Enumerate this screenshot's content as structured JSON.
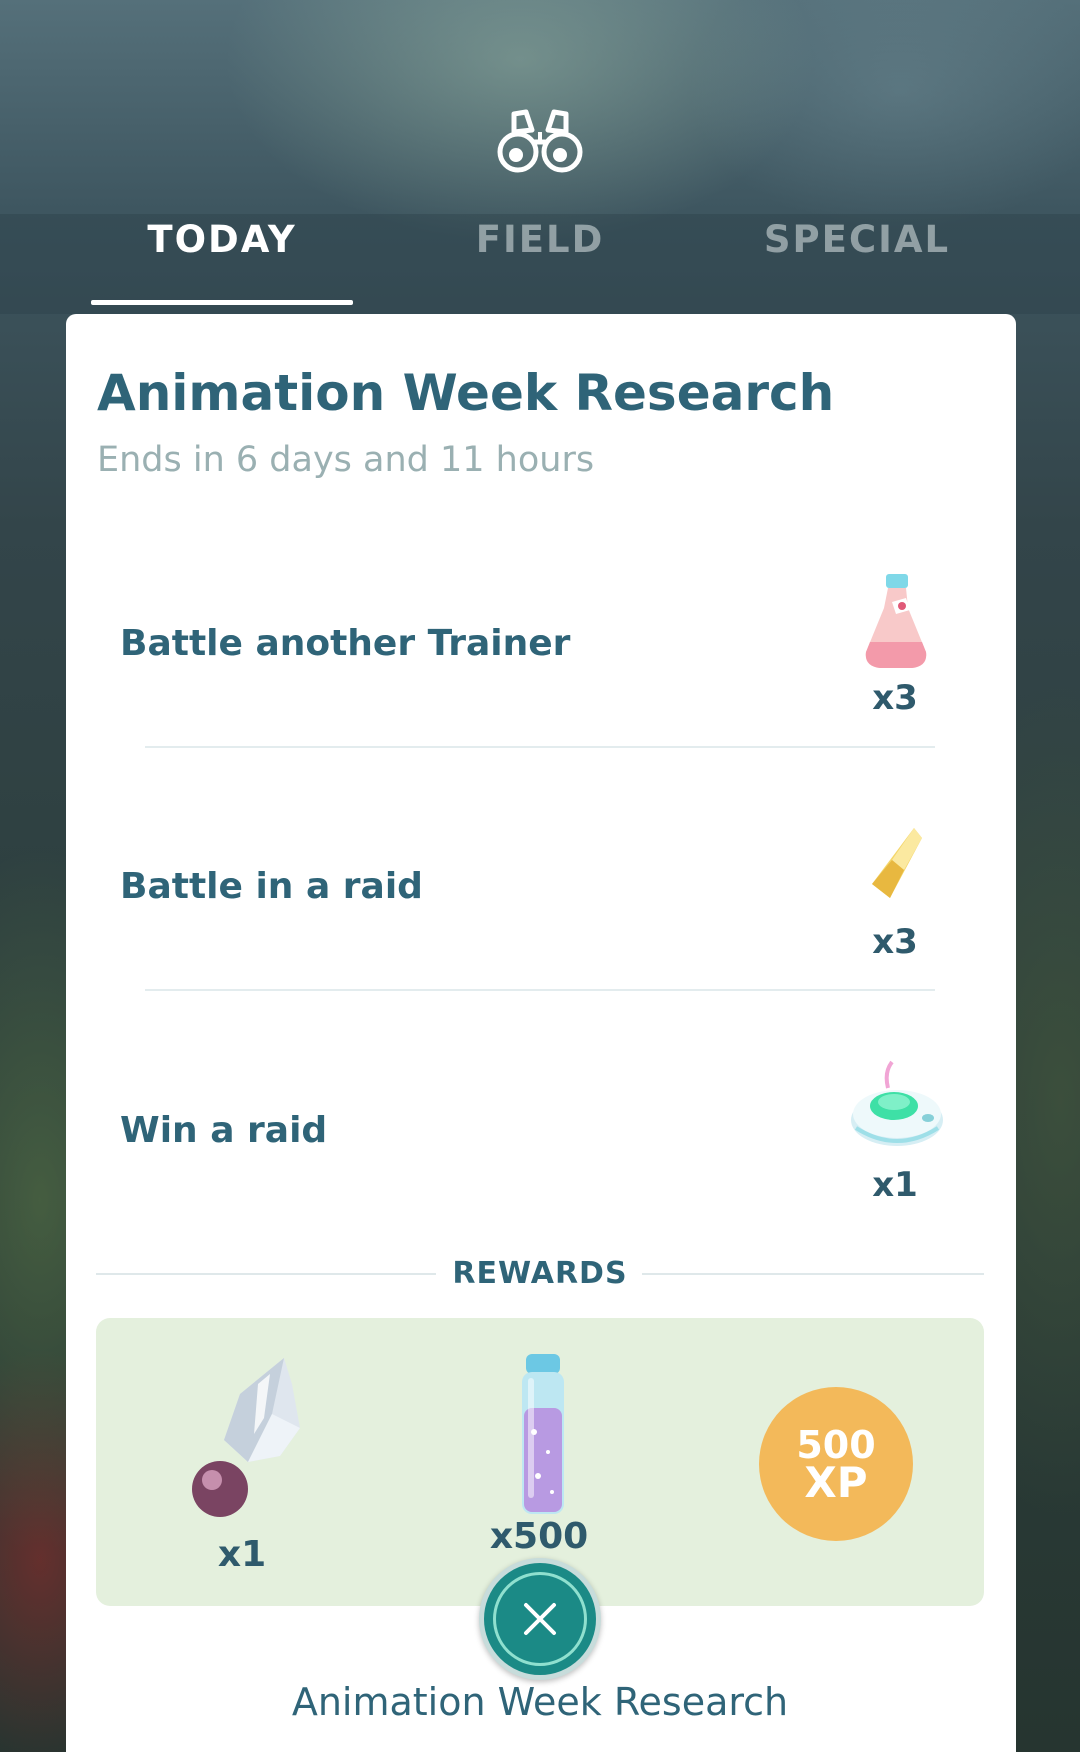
{
  "header": {
    "icon": "binoculars-icon"
  },
  "tabs": [
    {
      "label": "TODAY",
      "active": true
    },
    {
      "label": "FIELD",
      "active": false
    },
    {
      "label": "SPECIAL",
      "active": false
    }
  ],
  "research": {
    "title": "Animation Week Research",
    "subtitle": "Ends in 6 days and 11 hours",
    "tasks": [
      {
        "label": "Battle another Trainer",
        "reward_icon": "super-potion-icon",
        "reward_count": "x3"
      },
      {
        "label": "Battle in a raid",
        "reward_icon": "golden-razz-berry-icon",
        "reward_count": "x3"
      },
      {
        "label": "Win a raid",
        "reward_icon": "incense-icon",
        "reward_count": "x1"
      }
    ],
    "rewards_label": "REWARDS",
    "rewards": [
      {
        "icon": "sinnoh-stone-icon",
        "count": "x1"
      },
      {
        "icon": "stardust-vial-icon",
        "count": "x500"
      },
      {
        "icon": "xp-badge",
        "amount": "500",
        "unit": "XP"
      }
    ]
  },
  "footer": {
    "close_icon": "close-icon",
    "title": "Animation Week Research"
  },
  "colors": {
    "accent": "#2f6478",
    "subtitle": "#9ab0b2",
    "rewards_bg": "#e4f0dd",
    "xp": "#f3b95a",
    "close_button": "#1b8a86"
  }
}
